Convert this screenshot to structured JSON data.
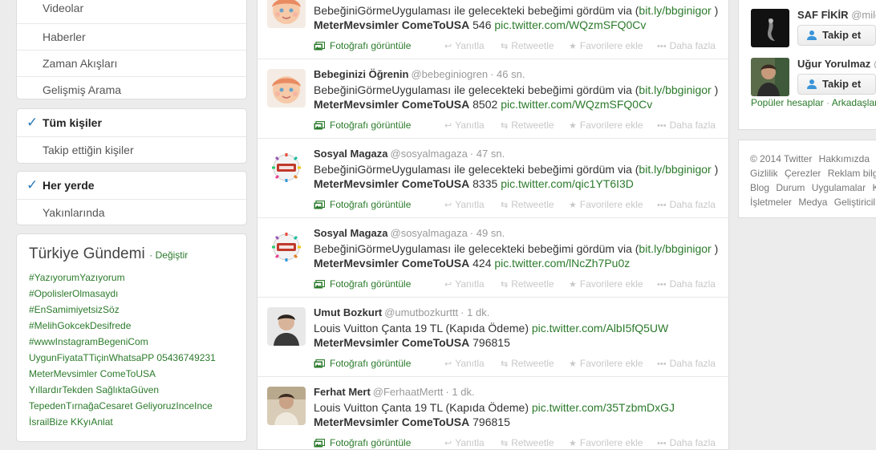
{
  "left_nav": {
    "search_menu": [
      "Videolar",
      "Haberler",
      "Zaman Akışları",
      "Gelişmiş Arama"
    ],
    "people_filter": [
      {
        "label": "Tüm kişiler",
        "selected": true
      },
      {
        "label": "Takip ettiğin kişiler",
        "selected": false
      }
    ],
    "location_filter": [
      {
        "label": "Her yerde",
        "selected": true
      },
      {
        "label": "Yakınlarında",
        "selected": false
      }
    ]
  },
  "trends": {
    "title": "Türkiye Gündemi",
    "change_label": "· Değiştir",
    "items": [
      "#YazıyorumYazıyorum",
      "#OpolislerOlmasaydı",
      "#EnSamimiyetsizSöz",
      "#MelihGokcekDesifrede",
      "#wwwInstagramBegeniCom",
      "UygunFiyataTTiçinWhatsaPP 05436749231",
      "MeterMevsimler ComeToUSA",
      "YıllardırTekden SağlıktaGüven",
      "TepedenTırnağaCesaret GeliyoruzInceInce",
      "İsrailBize KKyıAnlat"
    ]
  },
  "tweet_actions": {
    "photo": "Fotoğrafı görüntüle",
    "reply": "Yanıtla",
    "retweet": "Retweetle",
    "favorite": "Favorilere ekle",
    "more": "Daha fazla"
  },
  "tweets": [
    {
      "fullname": "",
      "username": "",
      "time": "",
      "text_pre": "BebeğiniGörmeUygulaması ile gelecekteki bebeğimi gördüm via (",
      "link1": "bit.ly/bbginigor",
      "text_mid": ")",
      "bold": "MeterMevsimler ComeToUSA",
      "count": "546",
      "link2": "pic.twitter.com/WQzmSFQ0Cv",
      "avatar": "baby"
    },
    {
      "fullname": "Bebeginizi Öğrenin",
      "username": "@bebeginiogren",
      "time": "46 sn.",
      "text_pre": "BebeğiniGörmeUygulaması ile gelecekteki bebeğimi gördüm via (",
      "link1": "bit.ly/bbginigor",
      "text_mid": ")",
      "bold": "MeterMevsimler ComeToUSA",
      "count": "8502",
      "link2": "pic.twitter.com/WQzmSFQ0Cv",
      "avatar": "baby"
    },
    {
      "fullname": "Sosyal Magaza",
      "username": "@sosyalmagaza",
      "time": "47 sn.",
      "text_pre": "BebeğiniGörmeUygulaması ile gelecekteki bebeğimi gördüm via (",
      "link1": "bit.ly/bbginigor",
      "text_mid": ")",
      "bold": "MeterMevsimler ComeToUSA",
      "count": "8335",
      "link2": "pic.twitter.com/qic1YT6I3D",
      "avatar": "logo"
    },
    {
      "fullname": "Sosyal Magaza",
      "username": "@sosyalmagaza",
      "time": "49 sn.",
      "text_pre": "BebeğiniGörmeUygulaması ile gelecekteki bebeğimi gördüm via (",
      "link1": "bit.ly/bbginigor",
      "text_mid": ")",
      "bold": "MeterMevsimler ComeToUSA",
      "count": "424",
      "link2": "pic.twitter.com/lNcZh7Pu0z",
      "avatar": "logo"
    },
    {
      "fullname": "Umut Bozkurt",
      "username": "@umutbozkurttt",
      "time": "1 dk.",
      "text_pre": "Louis Vuitton Çanta 19 TL (Kapıda  Ödeme)",
      "link1": "pic.twitter.com/AlbI5fQ5UW",
      "text_mid": "",
      "bold": "MeterMevsimler ComeToUSA",
      "count": "796815",
      "link2": "",
      "avatar": "man1"
    },
    {
      "fullname": "Ferhat Mert",
      "username": "@FerhaatMertt",
      "time": "1 dk.",
      "text_pre": "Louis Vuitton Çanta 19 TL (Kapıda  Ödeme)",
      "link1": "pic.twitter.com/35TzbmDxGJ",
      "text_mid": "",
      "bold": "MeterMevsimler ComeToUSA",
      "count": "796815",
      "link2": "",
      "avatar": "man2"
    }
  ],
  "who_to_follow": {
    "accounts": [
      {
        "name": "SAF FİKİR",
        "handle": "@mile"
      },
      {
        "name": "Uğur Yorulmaz",
        "handle": "@"
      }
    ],
    "follow_label": "Takip et",
    "popular_label": "Popüler hesaplar",
    "friends_label": "Arkadaşları"
  },
  "footer": {
    "links": [
      "© 2014 Twitter",
      "Hakkımızda",
      "Gizlilik",
      "Çerezler",
      "Reklam bilg",
      "Blog",
      "Durum",
      "Uygulamalar",
      "K",
      "İşletmeler",
      "Medya",
      "Geliştiricil"
    ]
  }
}
